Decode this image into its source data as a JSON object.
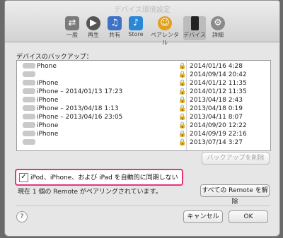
{
  "window": {
    "title": "デバイス環境設定"
  },
  "toolbar": {
    "items": [
      {
        "label": "一般",
        "icon": "switch-icon"
      },
      {
        "label": "再生",
        "icon": "play-icon"
      },
      {
        "label": "共有",
        "icon": "share-icon"
      },
      {
        "label": "Store",
        "icon": "store-icon"
      },
      {
        "label": "ペアレンタル",
        "icon": "person-icon"
      },
      {
        "label": "デバイス",
        "icon": "iphone-icon"
      },
      {
        "label": "詳細",
        "icon": "gear-icon"
      }
    ],
    "active": "デバイス"
  },
  "backups": {
    "heading": "デバイスのバックアップ：",
    "rows": [
      {
        "name": "Phone",
        "date": "2014/01/16 4:28"
      },
      {
        "name": "",
        "date": "2014/09/14 20:42"
      },
      {
        "name": "iPhone",
        "date": "2014/01/12 11:35"
      },
      {
        "name": "iPhone – 2014/01/13 17:23",
        "date": "2014/01/12 11:35"
      },
      {
        "name": "iPhone",
        "date": "2013/04/18 2:43"
      },
      {
        "name": "iPhone – 2013/04/18 1:13",
        "date": "2013/04/18 0:19"
      },
      {
        "name": "iPhone – 2013/04/16 23:05",
        "date": "2013/04/11 8:07"
      },
      {
        "name": "iPhone",
        "date": "2014/09/20 12:22"
      },
      {
        "name": "iPhone",
        "date": "2014/09/19 22:16"
      },
      {
        "name": "",
        "date": "2013/07/14 3:27"
      }
    ],
    "delete_button": "バックアップを削除"
  },
  "sync": {
    "checkbox_label": "iPod、iPhone、および iPad を自動的に同期しない",
    "checked": true
  },
  "remote": {
    "status": "現在 1 個の Remote がペアリングされています。",
    "unpair_button": "すべての Remote を解除"
  },
  "footer": {
    "help": "?",
    "cancel": "キャンセル",
    "ok": "OK"
  }
}
